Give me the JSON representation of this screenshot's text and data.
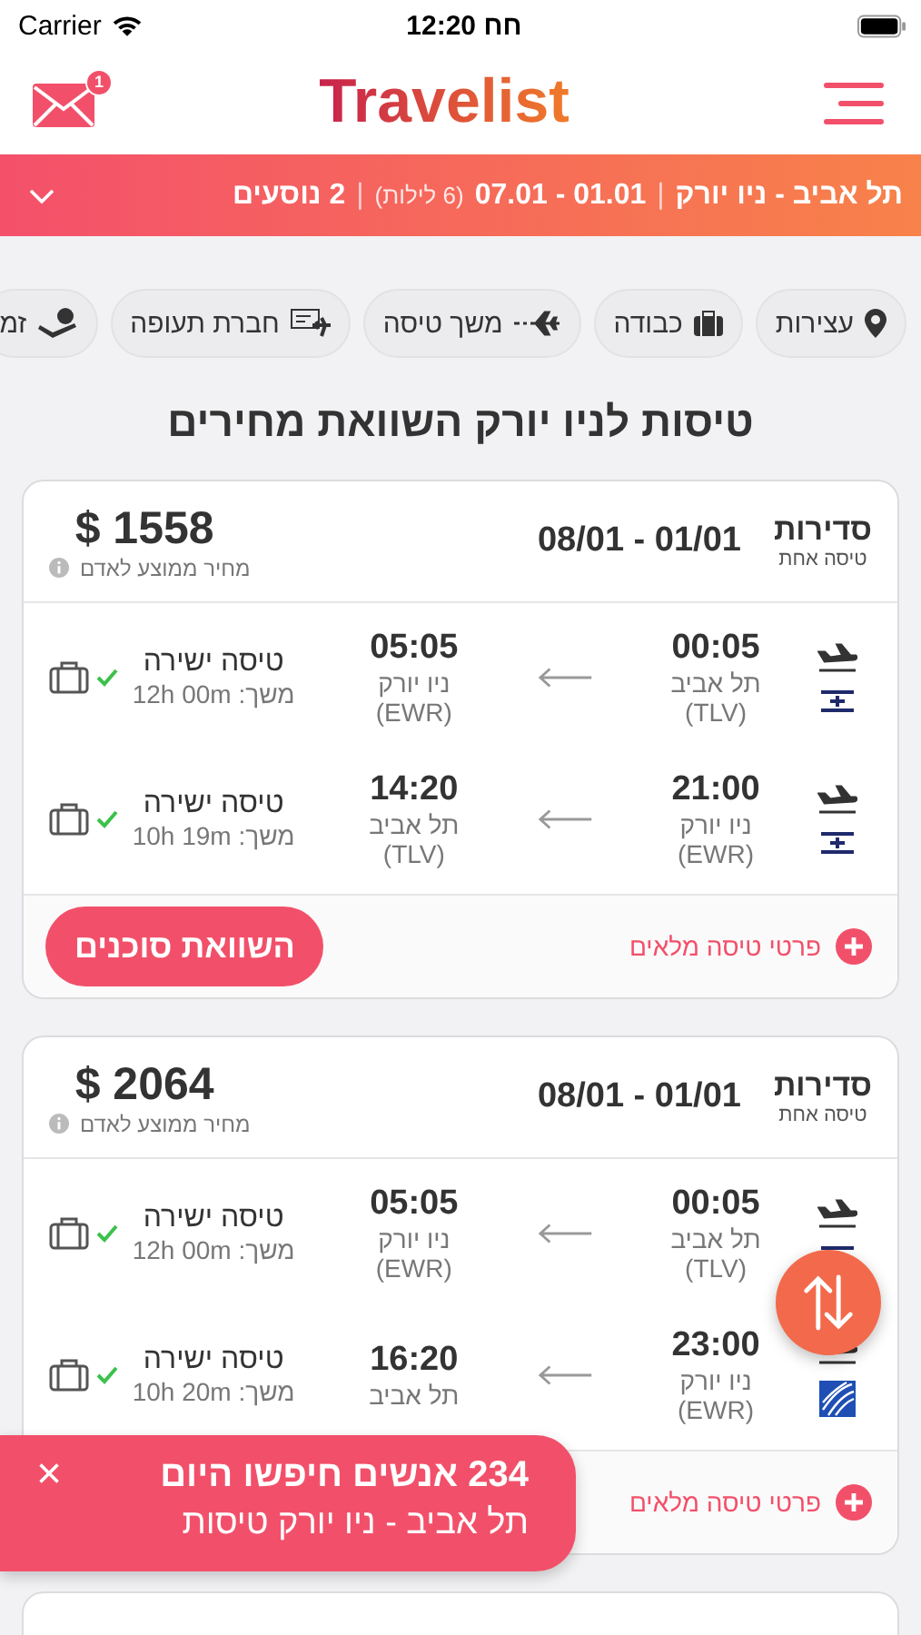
{
  "status_bar": {
    "carrier": "Carrier",
    "time": "12:20 חח"
  },
  "header": {
    "logo": "Travelist",
    "mail_badge": "1"
  },
  "search_summary": [
    {
      "kind": "main",
      "text": "תל אביב - ניו יורק"
    },
    {
      "kind": "sep",
      "text": "|"
    },
    {
      "kind": "num",
      "text": "07.01 - 01.01"
    },
    {
      "kind": "muted",
      "text": "(6 לילות)"
    },
    {
      "kind": "sep",
      "text": "|"
    },
    {
      "kind": "main",
      "text": "2 נוסעים"
    }
  ],
  "filters": [
    {
      "label": "עצירות"
    },
    {
      "label": "כבודה"
    },
    {
      "label": "משך טיסה"
    },
    {
      "label": "חברת תעופה"
    },
    {
      "label": "זמ"
    }
  ],
  "title": "טיסות לניו יורק השוואת מחירים",
  "results": [
    {
      "airline": "סדירות",
      "trip_type": "טיסה אחת",
      "dates": "08/01 - 01/01",
      "price": "$ 1558",
      "price_note": "מחיר ממוצע לאדם",
      "legs": [
        {
          "kind": "flag",
          "dep_time": "00:05",
          "dep_city": "תל אביב",
          "dep_code": "(TLV)",
          "arr_time": "05:05",
          "arr_city": "ניו יורק",
          "arr_code": "(EWR)",
          "stops": "טיסה ישירה",
          "duration": "משך: 12h 00m",
          "baggage_included": true
        },
        {
          "kind": "flag",
          "dep_time": "21:00",
          "dep_city": "ניו יורק",
          "dep_code": "(EWR)",
          "arr_time": "14:20",
          "arr_city": "תל אביב",
          "arr_code": "(TLV)",
          "stops": "טיסה ישירה",
          "duration": "משך: 10h 19m",
          "baggage_included": true
        }
      ],
      "details_link": "פרטי טיסה מלאים",
      "compare_button": "השוואת סוכנים"
    },
    {
      "airline": "סדירות",
      "trip_type": "טיסה אחת",
      "dates": "08/01 - 01/01",
      "price": "$ 2064",
      "price_note": "מחיר ממוצע לאדם",
      "legs": [
        {
          "kind": "flag",
          "dep_time": "00:05",
          "dep_city": "תל אביב",
          "dep_code": "(TLV)",
          "arr_time": "05:05",
          "arr_city": "ניו יורק",
          "arr_code": "(EWR)",
          "stops": "טיסה ישירה",
          "duration": "משך: 12h 00m",
          "baggage_included": true
        },
        {
          "kind": "globe",
          "dep_time": "23:00",
          "dep_city": "ניו יורק",
          "dep_code": "(EWR)",
          "arr_time": "16:20",
          "arr_city": "תל אביב",
          "stops": "טיסה ישירה",
          "duration": "משך: 10h 20m",
          "baggage_included": true
        }
      ],
      "details_link": "פרטי טיסה מלאים"
    }
  ],
  "toast": {
    "headline": "234 אנשים חיפשו היום",
    "subtitle": "תל אביב - ניו יורק טיסות",
    "close": "×"
  }
}
